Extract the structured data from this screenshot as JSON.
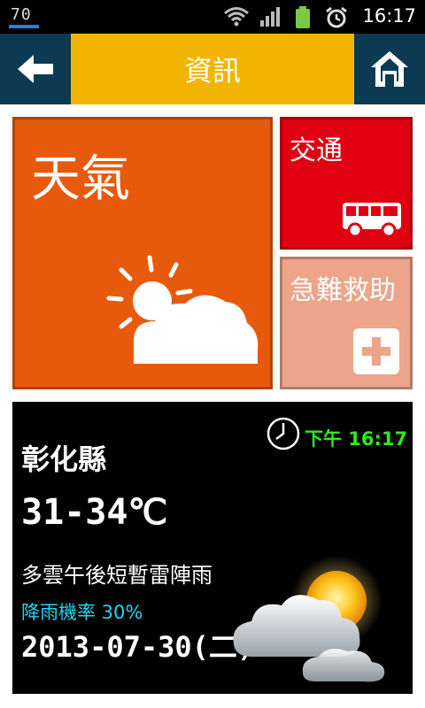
{
  "status_bar": {
    "notification_number": "70",
    "time": "16:17",
    "icons": [
      "wifi-icon",
      "signal-icon",
      "battery-icon",
      "alarm-icon"
    ]
  },
  "header": {
    "title": "資訊",
    "back_icon": "arrow-left-icon",
    "home_icon": "home-icon"
  },
  "tiles": {
    "weather": {
      "label": "天氣",
      "color": "#e85a0b",
      "icon": "sun-cloud-icon"
    },
    "traffic": {
      "label": "交通",
      "color": "#e00012",
      "icon": "bus-icon"
    },
    "emergency": {
      "label": "急難救助",
      "color": "#eca48a",
      "icon": "plus-icon"
    }
  },
  "weather_panel": {
    "time_label": "下午 16:17",
    "city": "彰化縣",
    "temperature": "31-34℃",
    "description": "多雲午後短暫雷陣雨",
    "rain_chance": "降雨機率 30%",
    "date": "2013-07-30(二)",
    "clock_icon": "clock-icon",
    "weather_art": "sun-behind-cloud-icon"
  },
  "colors": {
    "header_bg": "#0b3a52",
    "title_bg": "#f2b400",
    "rain_text": "#22d6ee",
    "clock_text": "#2eea1e"
  }
}
